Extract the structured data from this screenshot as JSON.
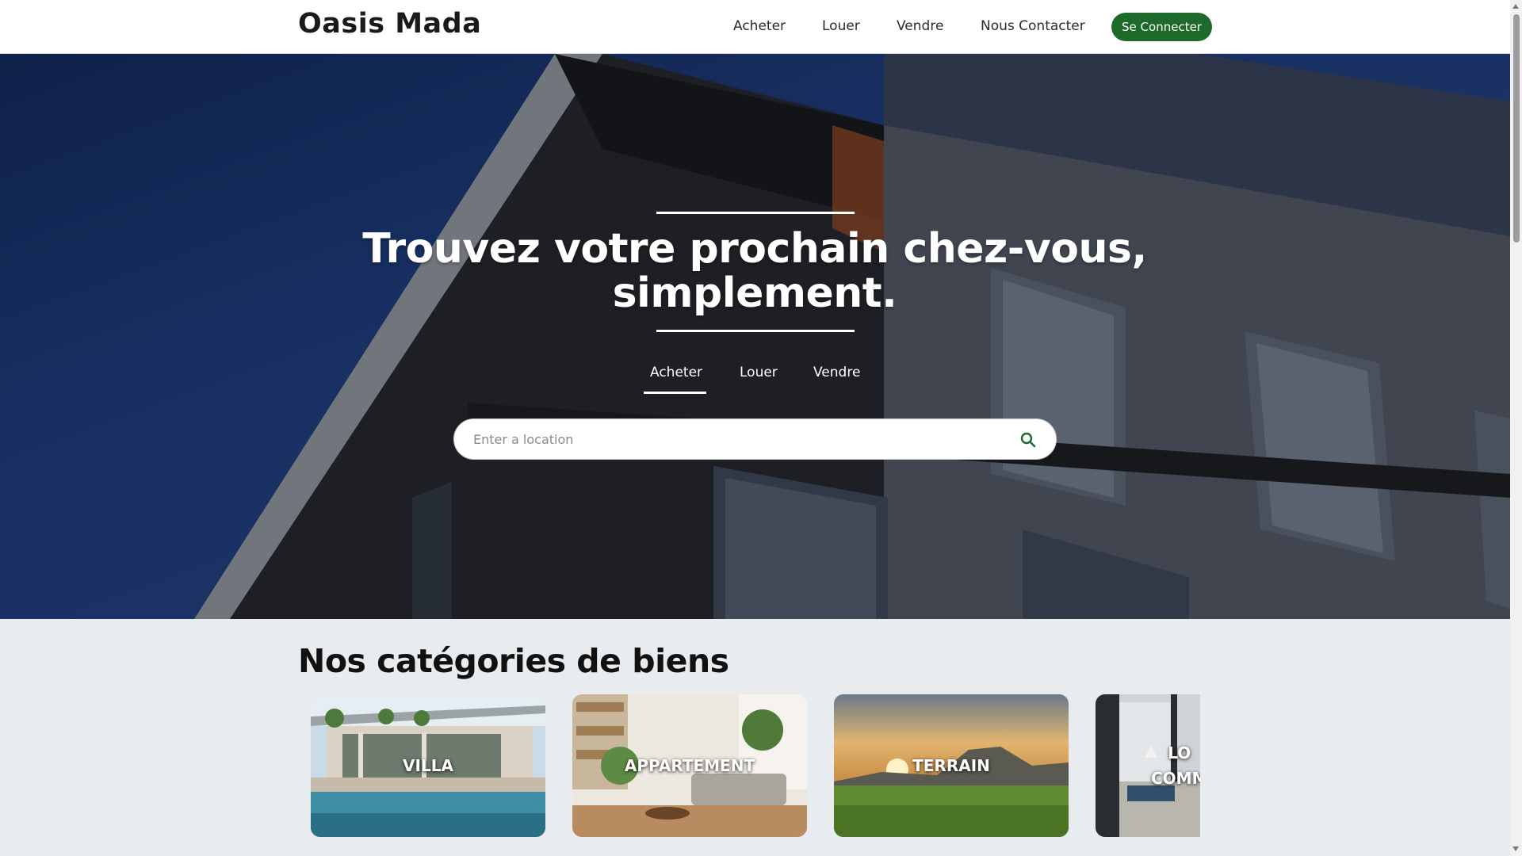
{
  "brand": {
    "name": "Oasis Mada",
    "accent": "#1d6a2a"
  },
  "nav": {
    "links": [
      "Acheter",
      "Louer",
      "Vendre",
      "Nous Contacter"
    ],
    "login_label": "Se Connecter"
  },
  "hero": {
    "title_line1": "Trouvez votre prochain chez-vous,",
    "title_line2": "simplement.",
    "tabs": [
      "Acheter",
      "Louer",
      "Vendre"
    ],
    "active_tab": "Acheter",
    "search": {
      "placeholder": "Enter a location",
      "value": "",
      "icon": "search-icon"
    }
  },
  "categories": {
    "title": "Nos catégories de biens",
    "items": [
      {
        "label": "VILLA",
        "label_line2": ""
      },
      {
        "label": "APPARTEMENT",
        "label_line2": ""
      },
      {
        "label": "TERRAIN",
        "label_line2": ""
      },
      {
        "label": "LO",
        "label_line2": "COMM"
      }
    ]
  }
}
